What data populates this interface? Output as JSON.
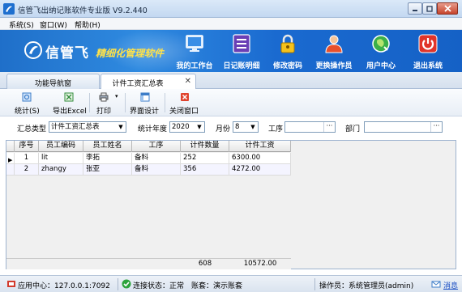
{
  "window": {
    "title": "信管飞出纳记账软件专业版 V9.2.440"
  },
  "menu": [
    "系统(S)",
    "窗口(W)",
    "帮助(H)"
  ],
  "banner": {
    "logo_text": "信管飞",
    "slogan": "精细化管理软件",
    "buttons": [
      {
        "label": "我的工作台",
        "icon": "monitor-icon"
      },
      {
        "label": "日记账明细",
        "icon": "list-icon"
      },
      {
        "label": "修改密码",
        "icon": "lock-icon"
      },
      {
        "label": "更换操作员",
        "icon": "user-icon"
      },
      {
        "label": "用户中心",
        "icon": "globe-icon"
      },
      {
        "label": "退出系统",
        "icon": "power-icon"
      }
    ]
  },
  "tabs": [
    {
      "label": "功能导航窗",
      "active": false
    },
    {
      "label": "计件工资汇总表",
      "active": true
    }
  ],
  "toolbar": {
    "stats": "统计(S)",
    "export": "导出Excel",
    "print": "打印",
    "layout": "界面设计",
    "close": "关闭窗口"
  },
  "filters": {
    "summary_type_label": "汇总类型",
    "summary_type_value": "计件工资汇总表",
    "year_label": "统计年度",
    "year_value": "2020",
    "month_label": "月份",
    "month_value": "8",
    "process_label": "工序",
    "process_value": "",
    "dept_label": "部门",
    "dept_value": ""
  },
  "grid": {
    "columns": [
      "序号",
      "员工编码",
      "员工姓名",
      "工序",
      "计件数量",
      "计件工资"
    ],
    "rows": [
      [
        "1",
        "lit",
        "李拓",
        "备料",
        "252",
        "6300.00"
      ],
      [
        "2",
        "zhangy",
        "张亚",
        "备料",
        "356",
        "4272.00"
      ]
    ],
    "totals": {
      "quantity": "608",
      "wage": "10572.00"
    }
  },
  "status": {
    "app_center": "应用中心：127.0.0.1:7092",
    "connection": "连接状态：正常",
    "account": "账套：演示账套",
    "operator": "操作员：系统管理员(admin)",
    "message": "消息"
  }
}
